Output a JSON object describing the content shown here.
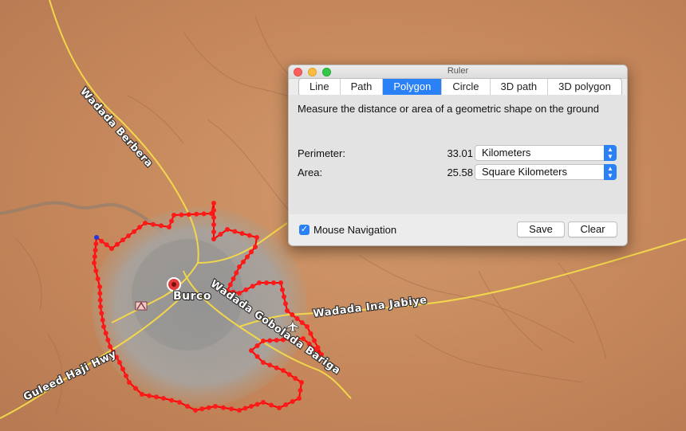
{
  "map": {
    "roads": [
      "Wadada Berbera",
      "Wadada Ina Jabiye",
      "Wadada Gobolada Bariga",
      "Guleed Haji Hwy"
    ],
    "city": "Burco",
    "colors": {
      "polygon": "#ff0000",
      "road": "#f2d64b",
      "terrain": "#c98a5c",
      "urban": "#a0a0a0"
    },
    "marker_icon": "red-pin-icon",
    "poi_icons": [
      "tent-icon",
      "airplane-icon"
    ]
  },
  "ruler": {
    "title": "Ruler",
    "tabs": [
      "Line",
      "Path",
      "Polygon",
      "Circle",
      "3D path",
      "3D polygon"
    ],
    "active_tab": "Polygon",
    "description": "Measure the distance or area of a geometric shape on the ground",
    "perimeter": {
      "label": "Perimeter:",
      "value": "33.01",
      "unit": "Kilometers"
    },
    "area": {
      "label": "Area:",
      "value": "25.58",
      "unit": "Square Kilometers"
    },
    "mouse_navigation": {
      "label": "Mouse Navigation",
      "checked": true
    },
    "save_label": "Save",
    "clear_label": "Clear"
  }
}
